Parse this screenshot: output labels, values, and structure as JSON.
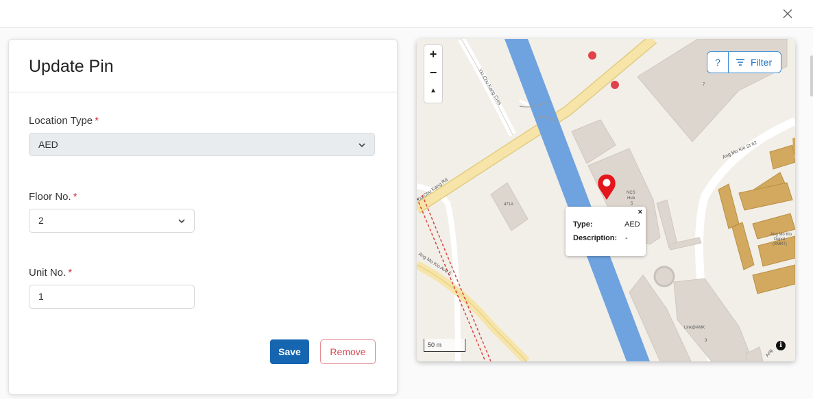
{
  "modal": {
    "close_icon": "close-icon"
  },
  "form": {
    "title": "Update Pin",
    "location_type": {
      "label": "Location Type",
      "required_mark": "*",
      "value": "AED"
    },
    "floor_no": {
      "label": "Floor No.",
      "required_mark": "*",
      "value": "2"
    },
    "unit_no": {
      "label": "Unit No.",
      "required_mark": "*",
      "value": "1"
    },
    "save_label": "Save",
    "remove_label": "Remove"
  },
  "map": {
    "zoom_in": "+",
    "zoom_out": "−",
    "reset_bearing": "▲",
    "help_label": "?",
    "filter_label": "Filter",
    "popup": {
      "close": "×",
      "type_key": "Type:",
      "type_value": "AED",
      "description_key": "Description:",
      "description_value": "-"
    },
    "scale_label": "50 m",
    "info_label": "i",
    "street_labels": {
      "yio_chu_kang_cres": "Yio Chu Kang Cres",
      "yio_chu_kang_rd": "Yio Chu Kang Rd",
      "ang_mo_kio_st_62": "Ang Mo Kio St 62",
      "ang_mo_kio_ave_5": "Ang Mo Kio Ave 5",
      "ang_mo_kio_short": "Ang"
    },
    "place_labels": {
      "ncs_hub": "NCS",
      "ncs_hub_2": "Hub",
      "ncs_hub_no": "5",
      "block_471a": "471A",
      "building_7": "7",
      "depot_1": "Ang Mo Kio",
      "depot_2": "Depot",
      "depot_3": "(SMRT)",
      "link_amk": "Link@AMK",
      "link_amk_no": "3"
    },
    "colors": {
      "land": "#f2efe9",
      "canal": "#6fa3e0",
      "building": "#ddd6cf",
      "building_tan": "#d2a95e",
      "road_major": "#f6e4a8",
      "rail": "#d9443f",
      "pin": "#e5151c"
    }
  },
  "theme": {
    "primary": "#1565b0",
    "danger": "#d24a55",
    "required": "#d0313d"
  }
}
